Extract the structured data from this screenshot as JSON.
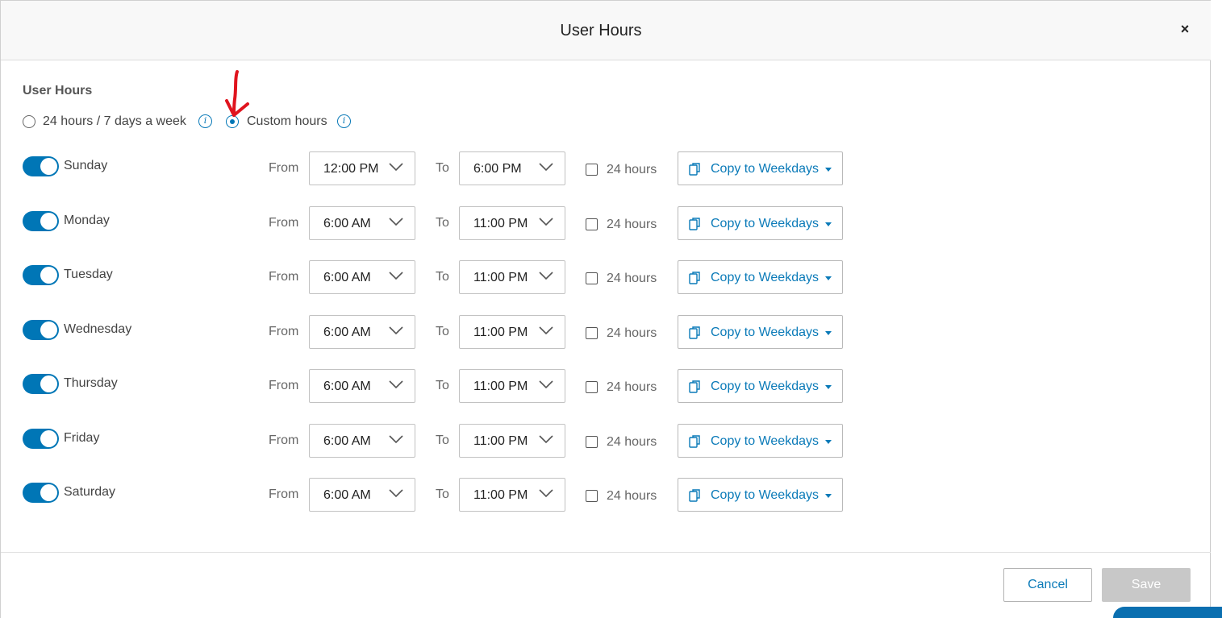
{
  "dialog": {
    "title": "User Hours",
    "close_label": "×"
  },
  "section": {
    "label": "User Hours"
  },
  "mode_options": [
    {
      "label": "24 hours / 7 days a week",
      "selected": false
    },
    {
      "label": "Custom hours",
      "selected": true
    }
  ],
  "info_icon_glyph": "i",
  "labels": {
    "from": "From",
    "to": "To",
    "all_day": "24 hours",
    "copy": "Copy to Weekdays"
  },
  "days": [
    {
      "name": "Sunday",
      "enabled": true,
      "from": "12:00 PM",
      "to": "6:00 PM",
      "all_day": false
    },
    {
      "name": "Monday",
      "enabled": true,
      "from": "6:00 AM",
      "to": "11:00 PM",
      "all_day": false
    },
    {
      "name": "Tuesday",
      "enabled": true,
      "from": "6:00 AM",
      "to": "11:00 PM",
      "all_day": false
    },
    {
      "name": "Wednesday",
      "enabled": true,
      "from": "6:00 AM",
      "to": "11:00 PM",
      "all_day": false
    },
    {
      "name": "Thursday",
      "enabled": true,
      "from": "6:00 AM",
      "to": "11:00 PM",
      "all_day": false
    },
    {
      "name": "Friday",
      "enabled": true,
      "from": "6:00 AM",
      "to": "11:00 PM",
      "all_day": false
    },
    {
      "name": "Saturday",
      "enabled": true,
      "from": "6:00 AM",
      "to": "11:00 PM",
      "all_day": false
    }
  ],
  "footer": {
    "cancel_label": "Cancel",
    "save_label": "Save"
  },
  "colors": {
    "accent": "#0076b6",
    "link": "#0a7ab8",
    "annotation": "#e0141e",
    "disabled_button": "#c8c8c8"
  },
  "icons": {
    "close": "close-icon",
    "info": "info-icon",
    "chevron": "chevron-down-icon",
    "copy": "copy-icon",
    "caret": "caret-down-icon",
    "annotation": "red-arrow-annotation"
  }
}
